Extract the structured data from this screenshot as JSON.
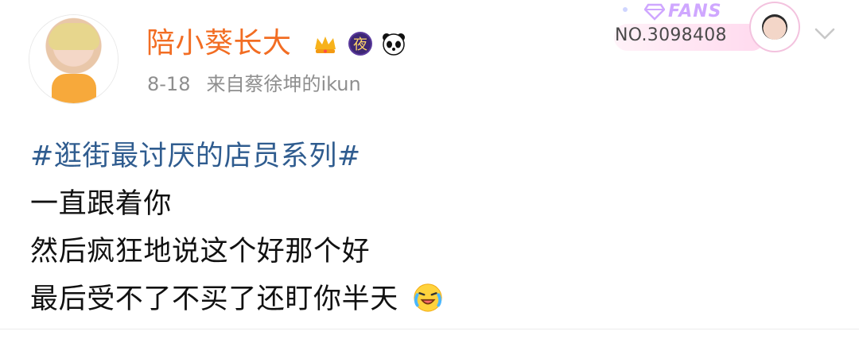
{
  "user": {
    "name": "陪小葵长大",
    "date": "8-18",
    "source": "来自蔡徐坤的ikun",
    "badges": [
      "crown-icon",
      "night-badge-icon",
      "panda-icon"
    ],
    "night_badge_text": "夜"
  },
  "fans_card": {
    "label": "FANS",
    "number": "NO.3098408"
  },
  "post": {
    "topic": "#逛街最讨厌的店员系列#",
    "lines": [
      "一直跟着你",
      "然后疯狂地说这个好那个好",
      "最后受不了不买了还盯你半天"
    ],
    "emoji": "laugh-cry-emoji"
  },
  "colors": {
    "username": "#f26d23",
    "topic": "#2f5c8f",
    "meta": "#8e8e8e",
    "text": "#111111"
  }
}
